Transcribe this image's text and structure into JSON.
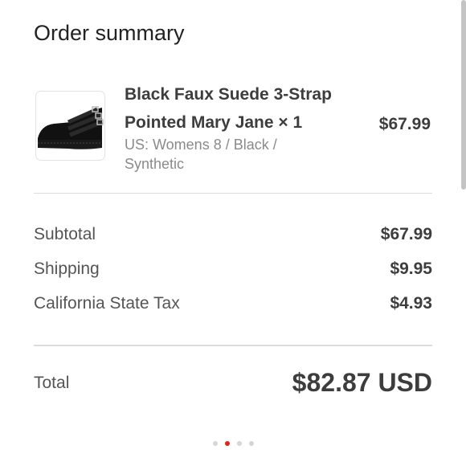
{
  "summary": {
    "title": "Order summary"
  },
  "item": {
    "name": "Black Faux Suede 3-Strap Pointed Mary Jane × 1",
    "variant": "US: Womens 8 / Black / Synthetic",
    "price": "$67.99",
    "image_icon": "black-mary-jane-shoe-icon"
  },
  "totals": {
    "subtotal_label": "Subtotal",
    "subtotal_value": "$67.99",
    "shipping_label": "Shipping",
    "shipping_value": "$9.95",
    "tax_label": "California State Tax",
    "tax_value": "$4.93",
    "total_label": "Total",
    "total_value": "$82.87 USD"
  },
  "pager": {
    "count": 4,
    "active_index": 1,
    "active_color": "#d8261c",
    "inactive_color": "#d6d6d6"
  }
}
